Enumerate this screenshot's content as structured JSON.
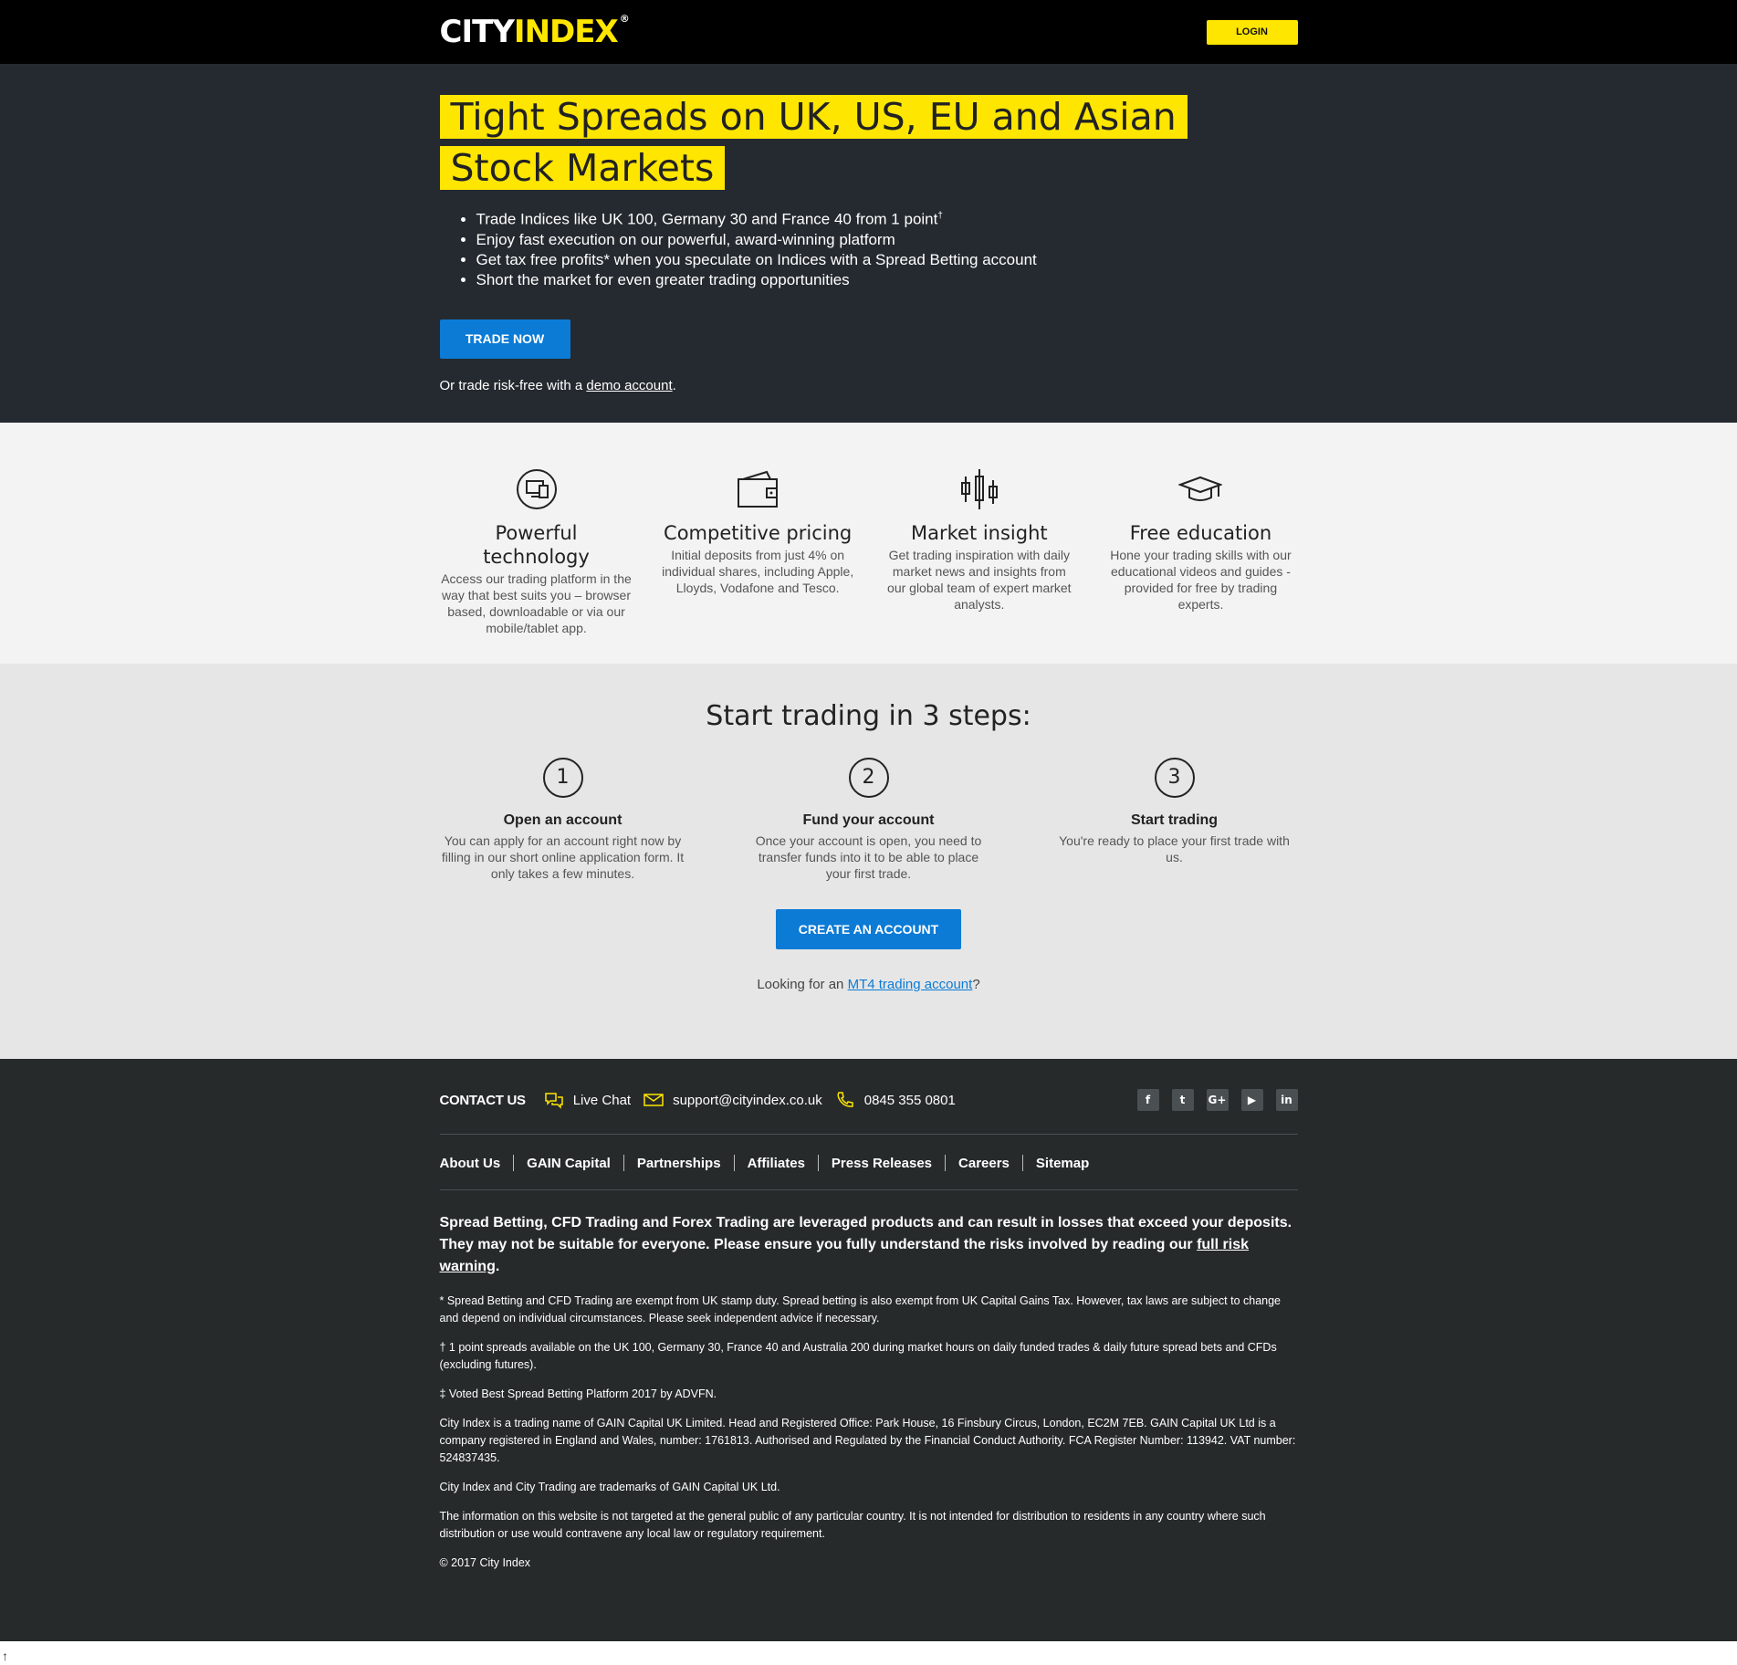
{
  "header": {
    "logo_city": "CITY",
    "logo_index": "INDEX",
    "logo_reg": "®",
    "login_label": "LOGIN"
  },
  "hero": {
    "title": "Tight Spreads on UK, US, EU and Asian Stock Markets",
    "bullets": [
      "Trade Indices like UK 100, Germany 30 and France 40 from 1 point",
      "Enjoy fast execution on our powerful, award-winning platform",
      "Get tax free profits* when you speculate on Indices with a Spread Betting account",
      "Short the market for even greater trading opportunities"
    ],
    "bullet1_sup": "†",
    "trade_now_label": "TRADE NOW",
    "demo_prefix": "Or trade risk-free with a ",
    "demo_link": "demo account",
    "demo_suffix": "."
  },
  "features": [
    {
      "icon": "monitor-tablet-icon",
      "title": "Powerful technology",
      "text": "Access our trading platform in the way that best suits you – browser based, downloadable or via our mobile/tablet app."
    },
    {
      "icon": "wallet-icon",
      "title": "Competitive pricing",
      "text": "Initial deposits from just 4% on individual shares, including Apple, Lloyds, Vodafone and Tesco."
    },
    {
      "icon": "candlestick-icon",
      "title": "Market insight",
      "text": "Get trading inspiration with daily market news and insights from our global team of expert market analysts."
    },
    {
      "icon": "graduation-cap-icon",
      "title": "Free education",
      "text": "Hone your trading skills with our educational videos and guides - provided for free by trading experts."
    }
  ],
  "steps": {
    "title": "Start trading in 3 steps:",
    "items": [
      {
        "num": "1",
        "title": "Open an account",
        "text": "You can apply for an account right now by filling in our short online application form. It only takes a few minutes."
      },
      {
        "num": "2",
        "title": "Fund your account",
        "text": "Once your account is open, you need to transfer funds into it to be able to place your first trade."
      },
      {
        "num": "3",
        "title": "Start trading",
        "text": "You're ready to place your first trade with us."
      }
    ],
    "create_label": "CREATE AN ACCOUNT",
    "mt4_prefix": "Looking for an ",
    "mt4_link": "MT4 trading account",
    "mt4_suffix": "?"
  },
  "footer": {
    "contact_label": "CONTACT US",
    "live_chat": "Live Chat",
    "email": "support@cityindex.co.uk",
    "phone": "0845 355 0801",
    "socials": [
      "f",
      "t",
      "G+",
      "▶",
      "in"
    ],
    "links": [
      "About Us",
      "GAIN Capital",
      "Partnerships",
      "Affiliates",
      "Press Releases",
      "Careers",
      "Sitemap"
    ],
    "risk_text": "Spread Betting, CFD Trading and Forex Trading are leveraged products and can result in losses that exceed your deposits. They may not be suitable for everyone. Please ensure you fully understand the risks involved by reading our ",
    "risk_link": "full risk warning",
    "risk_suffix": ".",
    "notes": [
      "* Spread Betting and CFD Trading are exempt from UK stamp duty. Spread betting is also exempt from UK Capital Gains Tax. However, tax laws are subject to change and depend on individual circumstances. Please seek independent advice if necessary.",
      "† 1 point spreads available on the UK 100, Germany 30, France 40 and Australia 200 during market hours on daily funded trades & daily future spread bets and CFDs (excluding futures).",
      "‡ Voted Best Spread Betting Platform 2017 by ADVFN.",
      "City Index is a trading name of GAIN Capital UK Limited. Head and Registered Office: Park House, 16 Finsbury Circus, London, EC2M 7EB. GAIN Capital UK Ltd is a company registered in England and Wales, number: 1761813. Authorised and Regulated by the Financial Conduct Authority. FCA Register Number: 113942. VAT number: 524837435.",
      "City Index and City Trading are trademarks of GAIN Capital UK Ltd.",
      "The information on this website is not targeted at the general public of any particular country. It is not intended for distribution to residents in any country where such distribution or use would contravene any local law or regulatory requirement.",
      "© 2017 City Index"
    ]
  },
  "colors": {
    "accent_yellow": "#ffe600",
    "button_blue": "#0b7bd6",
    "hero_bg": "#252a30",
    "footer_bg": "#262a2b"
  },
  "scroll_arrow": "↑"
}
